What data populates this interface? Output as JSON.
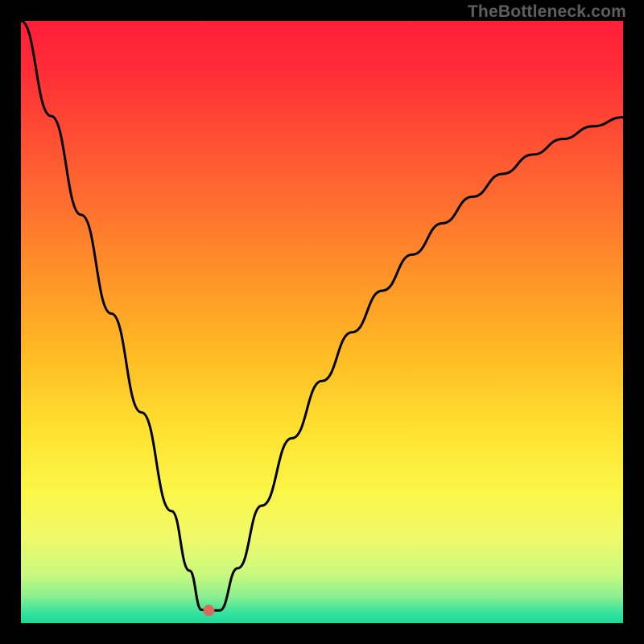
{
  "attribution": "TheBottleneck.com",
  "chart_data": {
    "type": "line",
    "title": "",
    "xlabel": "",
    "ylabel": "",
    "xlim": [
      0,
      100
    ],
    "ylim": [
      0,
      100
    ],
    "grid": false,
    "legend": false,
    "marker": {
      "x": 31.2,
      "y": 2.1,
      "color": "#d96a5e",
      "r": 7
    },
    "series": [
      {
        "name": "bottleneck-curve",
        "x": [
          0,
          5,
          10,
          15,
          20,
          25,
          28,
          30,
          31.2,
          33,
          36,
          40,
          45,
          50,
          55,
          60,
          65,
          70,
          75,
          80,
          85,
          90,
          95,
          100
        ],
        "values": [
          100,
          84.2,
          67.8,
          51.4,
          35.0,
          18.6,
          8.7,
          2.2,
          2.1,
          2.1,
          9.1,
          19.5,
          30.7,
          40.2,
          48.3,
          55.2,
          61.2,
          66.4,
          70.8,
          74.6,
          77.8,
          80.4,
          82.5,
          84.0
        ]
      }
    ],
    "background_gradient": {
      "stops": [
        {
          "offset": 0.0,
          "color": "#ff1f3a"
        },
        {
          "offset": 0.08,
          "color": "#ff2c37"
        },
        {
          "offset": 0.18,
          "color": "#ff4a33"
        },
        {
          "offset": 0.3,
          "color": "#ff6e2f"
        },
        {
          "offset": 0.42,
          "color": "#ff9228"
        },
        {
          "offset": 0.55,
          "color": "#ffba24"
        },
        {
          "offset": 0.68,
          "color": "#ffe130"
        },
        {
          "offset": 0.78,
          "color": "#fbf647"
        },
        {
          "offset": 0.86,
          "color": "#eff96a"
        },
        {
          "offset": 0.92,
          "color": "#c8f97f"
        },
        {
          "offset": 0.955,
          "color": "#8df08e"
        },
        {
          "offset": 0.98,
          "color": "#3de49d"
        },
        {
          "offset": 1.0,
          "color": "#15dc9b"
        }
      ]
    }
  }
}
